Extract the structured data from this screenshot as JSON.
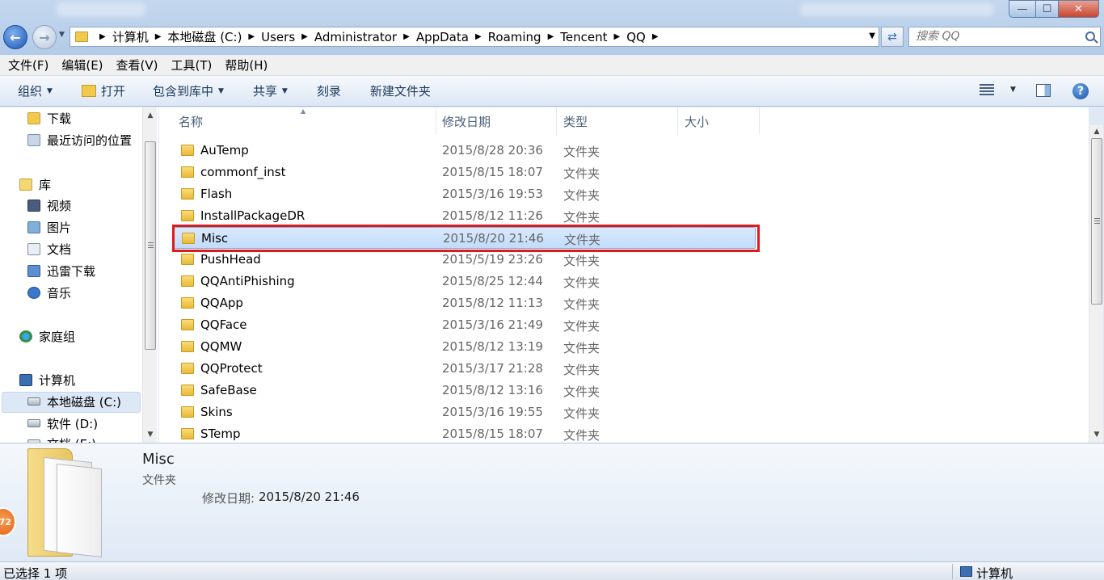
{
  "window": {
    "min_glyph": "—",
    "max_glyph": "☐",
    "close_glyph": "✕"
  },
  "address": {
    "crumbs": [
      "计算机",
      "本地磁盘 (C:)",
      "Users",
      "Administrator",
      "AppData",
      "Roaming",
      "Tencent",
      "QQ"
    ],
    "search_placeholder": "搜索 QQ"
  },
  "menu": [
    "文件(F)",
    "编辑(E)",
    "查看(V)",
    "工具(T)",
    "帮助(H)"
  ],
  "commands": {
    "organize": "组织",
    "open": "打开",
    "include_library": "包含到库中",
    "share": "共享",
    "burn": "刻录",
    "new_folder": "新建文件夹"
  },
  "nav": {
    "downloads": "下载",
    "recent": "最近访问的位置",
    "libraries": "库",
    "videos": "视频",
    "pictures": "图片",
    "documents": "文档",
    "xunlei": "迅雷下载",
    "music": "音乐",
    "homegroup": "家庭组",
    "computer": "计算机",
    "drive_c": "本地磁盘 (C:)",
    "drive_d": "软件 (D:)",
    "drive_e": "文档 (E:)"
  },
  "columns": {
    "name": "名称",
    "modified": "修改日期",
    "type": "类型",
    "size": "大小"
  },
  "files": [
    {
      "name": "AuTemp",
      "modified": "2015/8/28 20:36",
      "type": "文件夹"
    },
    {
      "name": "commonf_inst",
      "modified": "2015/8/15 18:07",
      "type": "文件夹"
    },
    {
      "name": "Flash",
      "modified": "2015/3/16 19:53",
      "type": "文件夹"
    },
    {
      "name": "InstallPackageDR",
      "modified": "2015/8/12 11:26",
      "type": "文件夹"
    },
    {
      "name": "Misc",
      "modified": "2015/8/20 21:46",
      "type": "文件夹"
    },
    {
      "name": "PushHead",
      "modified": "2015/5/19 23:26",
      "type": "文件夹"
    },
    {
      "name": "QQAntiPhishing",
      "modified": "2015/8/25 12:44",
      "type": "文件夹"
    },
    {
      "name": "QQApp",
      "modified": "2015/8/12 11:13",
      "type": "文件夹"
    },
    {
      "name": "QQFace",
      "modified": "2015/3/16 21:49",
      "type": "文件夹"
    },
    {
      "name": "QQMW",
      "modified": "2015/8/12 13:19",
      "type": "文件夹"
    },
    {
      "name": "QQProtect",
      "modified": "2015/3/17 21:28",
      "type": "文件夹"
    },
    {
      "name": "SafeBase",
      "modified": "2015/8/12 13:16",
      "type": "文件夹"
    },
    {
      "name": "Skins",
      "modified": "2015/3/16 19:55",
      "type": "文件夹"
    },
    {
      "name": "STemp",
      "modified": "2015/8/15 18:07",
      "type": "文件夹"
    }
  ],
  "selected_index": 4,
  "details": {
    "name": "Misc",
    "type": "文件夹",
    "modified_label": "修改日期:",
    "modified_value": "2015/8/20 21:46"
  },
  "tray_badge": "72",
  "status": {
    "text": "已选择 1 项",
    "location": "计算机"
  },
  "colors": {
    "highlight_border": "#e01a1a",
    "selection_fill": "#c1dcfb"
  }
}
